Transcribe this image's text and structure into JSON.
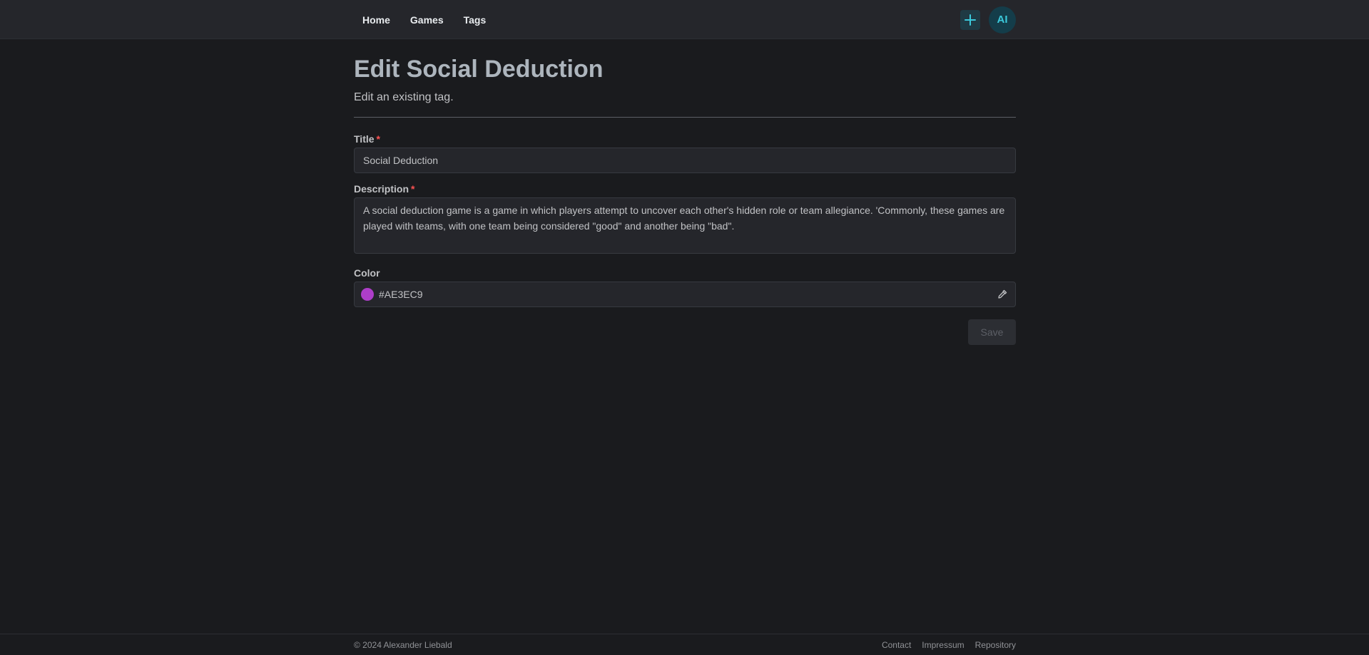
{
  "header": {
    "nav": [
      {
        "label": "Home"
      },
      {
        "label": "Games"
      },
      {
        "label": "Tags"
      }
    ],
    "add_icon": "plus-icon",
    "avatar_initials": "AI"
  },
  "page": {
    "title": "Edit Social Deduction",
    "subtitle": "Edit an existing tag."
  },
  "form": {
    "title": {
      "label": "Title",
      "required_mark": "*",
      "value": "Social Deduction"
    },
    "description": {
      "label": "Description",
      "required_mark": "*",
      "value": "A social deduction game is a game in which players attempt to uncover each other's hidden role or team allegiance. 'Commonly, these games are played with teams, with one team being considered \"good\" and another being \"bad\"."
    },
    "color": {
      "label": "Color",
      "value": "#AE3EC9",
      "swatch_color": "#AE3EC9",
      "picker_icon": "eyedropper-icon"
    },
    "save_label": "Save"
  },
  "footer": {
    "copyright": "© 2024 Alexander Liebald",
    "links": [
      {
        "label": "Contact"
      },
      {
        "label": "Impressum"
      },
      {
        "label": "Repository"
      }
    ]
  },
  "colors": {
    "background": "#1a1b1e",
    "surface": "#25262b",
    "accent": "#3bc9db",
    "required": "#fa5252"
  }
}
